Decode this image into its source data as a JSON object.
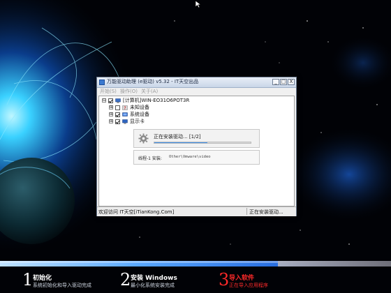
{
  "window": {
    "title": "万能驱动助理 (e驱动) v5.32 - IT天空出品",
    "buttons": {
      "minimize": "_",
      "maximize": "□",
      "close": "X"
    },
    "menu": [
      "开始(S)",
      "操作(O)",
      "关于(A)"
    ]
  },
  "tree": {
    "root": {
      "label": "[计算机]WIN-EO31O6POT3R",
      "expander": "⊟",
      "checked": true
    },
    "children": [
      {
        "label": "未知设备",
        "expander": "⊞",
        "checked": false
      },
      {
        "label": "系统设备",
        "expander": "⊞",
        "checked": true
      },
      {
        "label": "显示卡",
        "expander": "⊞",
        "checked": true
      }
    ]
  },
  "progress": {
    "label": "正在安装驱动... [1/2]",
    "fraction": 0.55
  },
  "thread": {
    "label": "线程-1 安装:",
    "path": "Other\\Vmware\\video"
  },
  "status": {
    "left": "欢迎访问 IT天空[iTianKong.Com]",
    "right": "正在安装驱动..."
  },
  "steps": [
    {
      "number": "1",
      "title": "初始化",
      "subtitle": "系统初始化和导入驱动完成",
      "active": false
    },
    {
      "number": "2",
      "title": "安装 Windows",
      "subtitle": "最小化系统安装完成",
      "active": false
    },
    {
      "number": "3",
      "title": "导入软件",
      "subtitle": "正在导入应用程序",
      "active": true
    }
  ],
  "colors": {
    "active_step": "#ff2a2a",
    "progress_fill": "#1e6fd1",
    "bottom_bar": "#2a6fe0"
  }
}
